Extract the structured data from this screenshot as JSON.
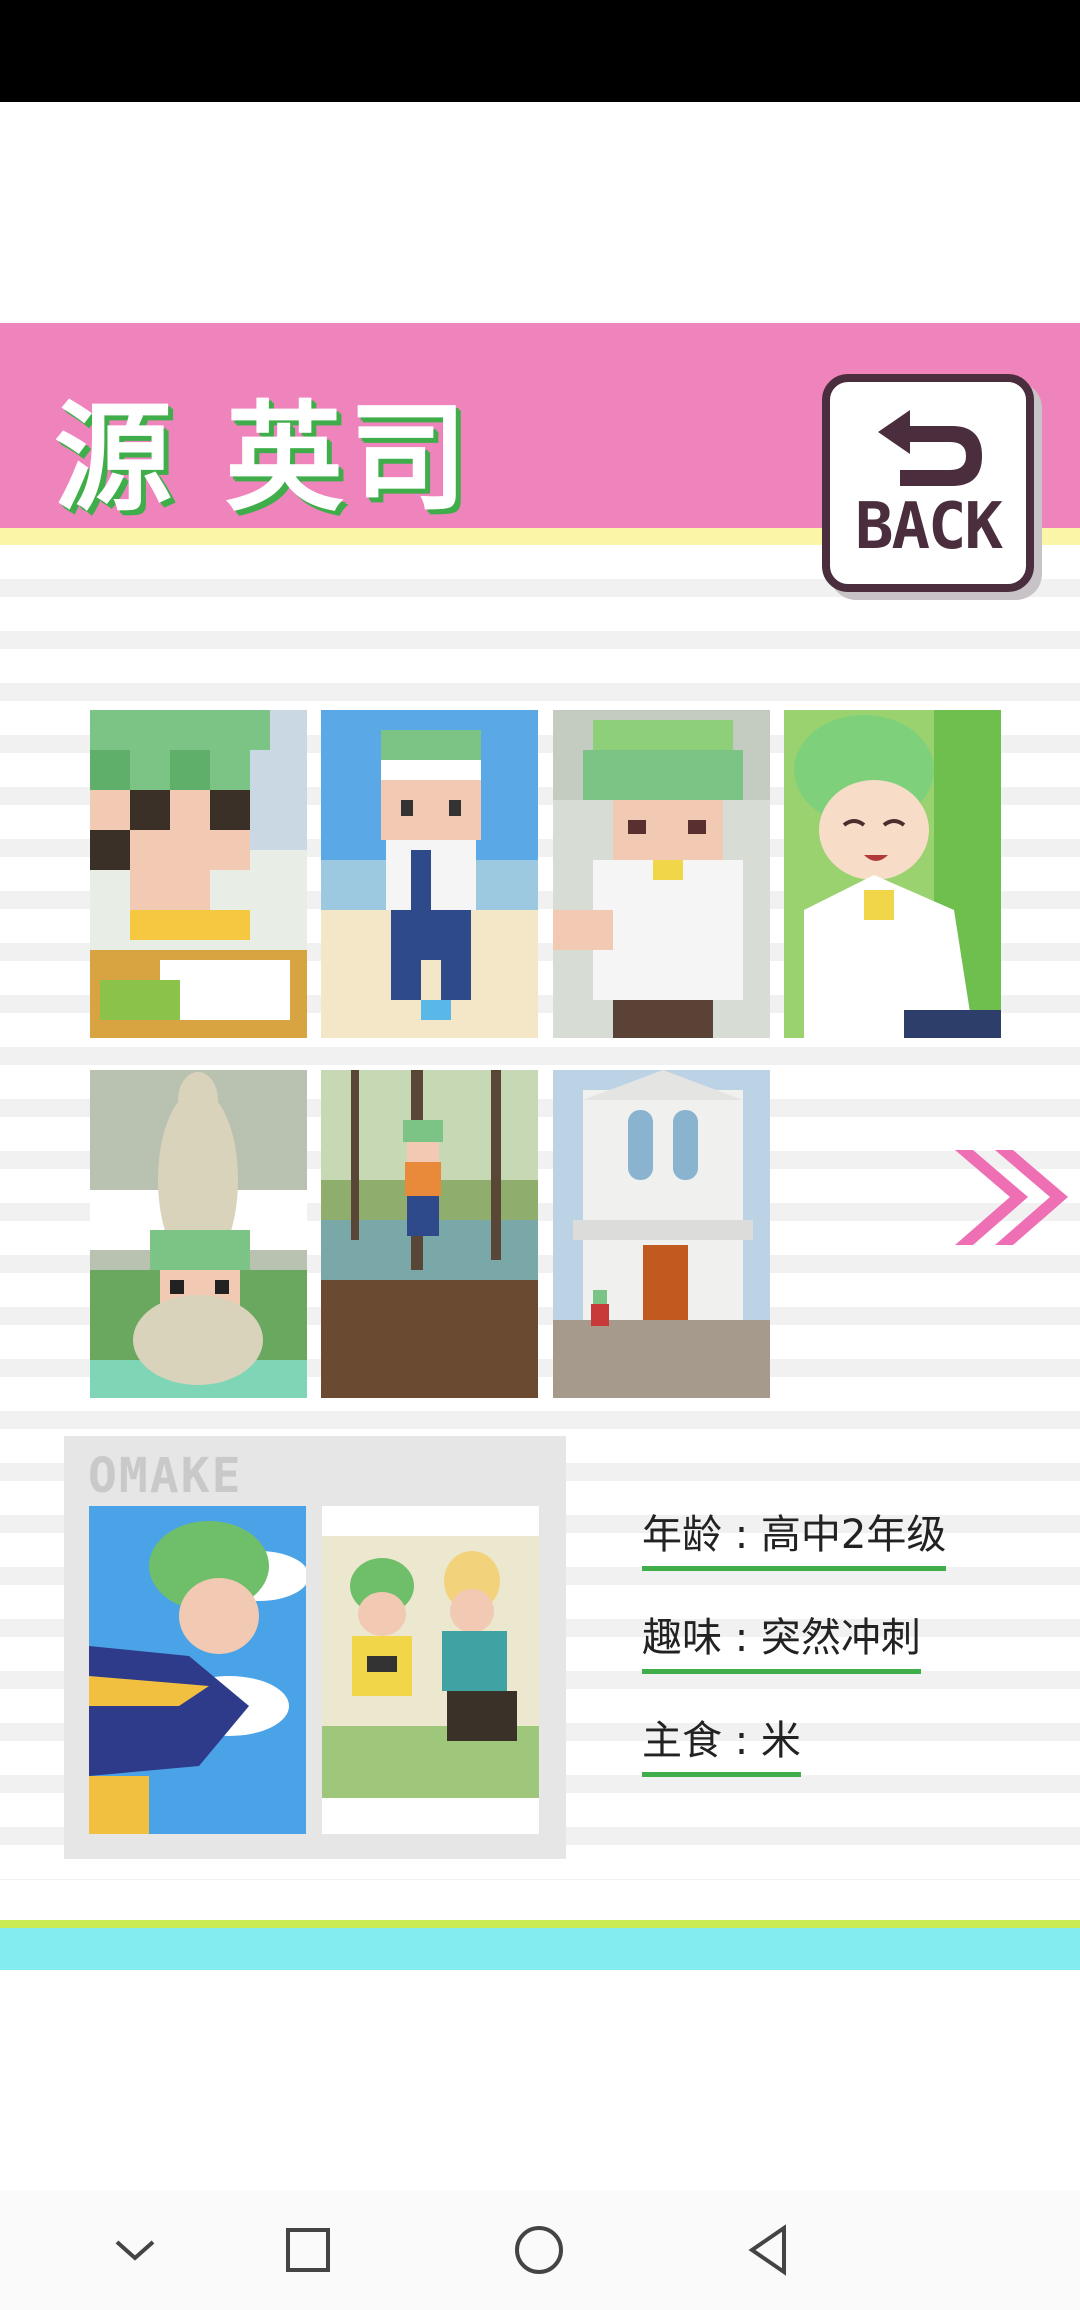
{
  "character": {
    "name": "源 英司"
  },
  "back_button": {
    "label": "BACK"
  },
  "gallery": {
    "row1": [
      "classroom-desk-pixel",
      "running-pixel",
      "white-shirt-pixel",
      "smiling-illustration"
    ],
    "row2": [
      "kangaroo-statue-pixel",
      "stream-pixel",
      "church-pixel"
    ]
  },
  "omake": {
    "title": "OMAKE",
    "images": [
      "sporty-illustration",
      "gaming-duo-illustration"
    ]
  },
  "profile": {
    "age": "年龄 : 高中2年级",
    "hobby": "趣味 : 突然冲刺",
    "staple": "主食 : 米"
  },
  "colors": {
    "header_pink": "#ef84bd",
    "name_shadow_green": "#3fae4a",
    "accent_pink": "#ef6fb4",
    "footer_cyan": "#83ecf0",
    "footer_lime": "#c9ec54"
  },
  "nav": [
    "chevron-down-icon",
    "square-icon",
    "circle-icon",
    "back-triangle-icon"
  ]
}
